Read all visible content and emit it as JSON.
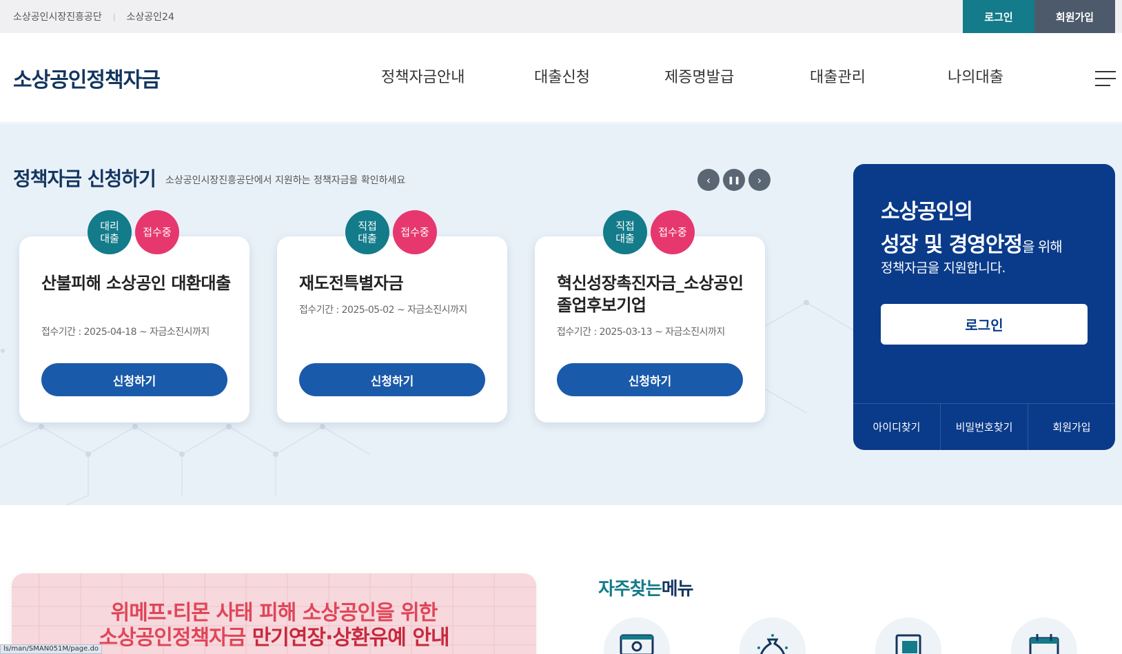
{
  "topbar": {
    "links": [
      "소상공인시장진흥공단",
      "소상공인24"
    ],
    "login_label": "로그인",
    "join_label": "회원가입"
  },
  "header": {
    "logo": "소상공인정책자금",
    "nav": [
      "정책자금안내",
      "대출신청",
      "제증명발급",
      "대출관리",
      "나의대출"
    ]
  },
  "hero": {
    "title": "정책자금 신청하기",
    "subtitle": "소상공인시장진흥공단에서 지원하는 정책자금을 확인하세요",
    "controls": {
      "prev": "‹",
      "pause": "❚❚",
      "next": "›"
    },
    "cards": [
      {
        "type_badge": "대리\n대출",
        "status_badge": "접수중",
        "title": "산불피해 소상공인 대환대출",
        "period": "접수기간 : 2025-04-18 ~ 자금소진시까지",
        "button": "신청하기"
      },
      {
        "type_badge": "직접\n대출",
        "status_badge": "접수중",
        "title": "재도전특별자금",
        "period": "접수기간 : 2025-05-02 ~ 자금소진시까지",
        "button": "신청하기"
      },
      {
        "type_badge": "직접\n대출",
        "status_badge": "접수중",
        "title": "혁신성장촉진자금_소상공인 졸업후보기업",
        "period": "접수기간 : 2025-03-13 ~ 자금소진시까지",
        "button": "신청하기"
      }
    ]
  },
  "loginbox": {
    "line1": "소상공인의",
    "line2_bold": "성장 및 경영안정",
    "line2_rest": "을 위해",
    "line3": "정책자금을 지원합니다.",
    "login_button": "로그인",
    "links": [
      "아이디찾기",
      "비밀번호찾기",
      "회원가입"
    ]
  },
  "notice": {
    "line1": "위메프·티몬 사태 피해 소상공인을 위한",
    "line2_a": "소상공인정책자금 ",
    "line2_b": "만기연장·상환유예 안내"
  },
  "favorites": {
    "title_a": "자주찾는",
    "title_b": "메뉴"
  },
  "statusbar": {
    "url": "ls/man/SMAN051M/page.do"
  },
  "colors": {
    "teal": "#137b8a",
    "navy": "#13355f",
    "button_blue": "#1a5aaa",
    "status_pink": "#e6386e",
    "loginbox_bg": "#0a3b8a"
  }
}
